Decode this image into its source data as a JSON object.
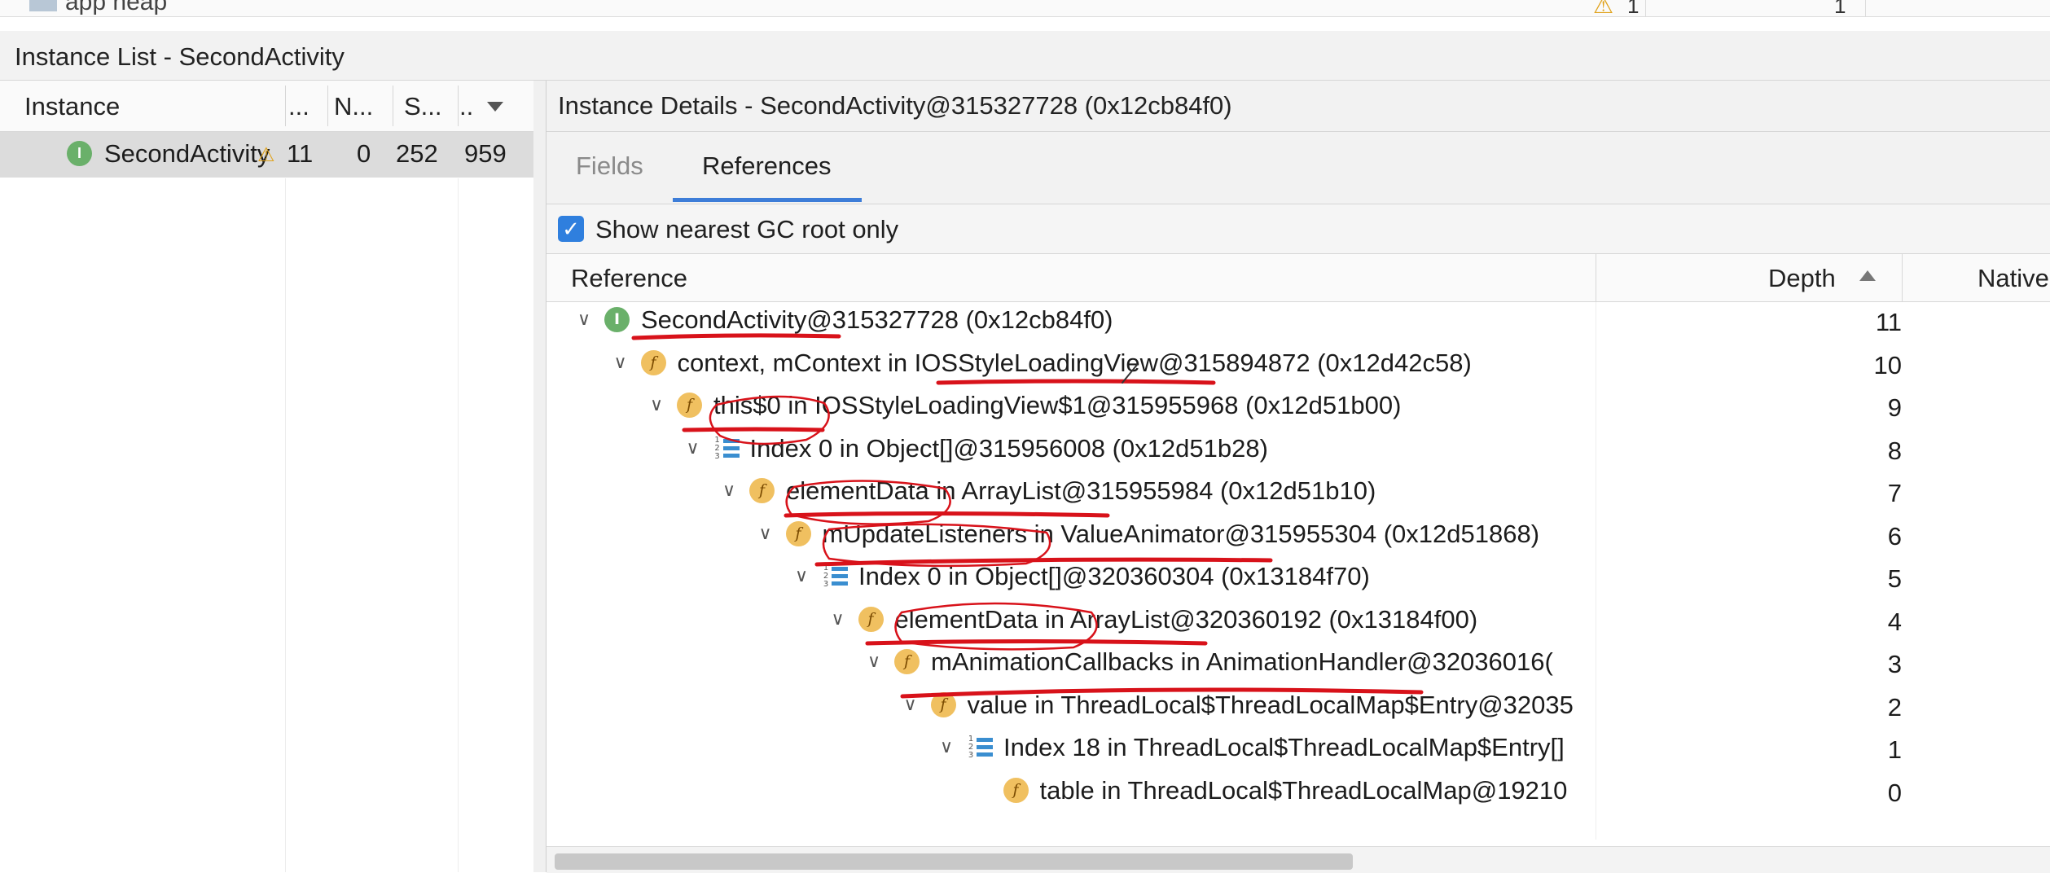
{
  "top_strip": {
    "title": "app heap",
    "warning_count": "1",
    "count": "1"
  },
  "instance_list": {
    "title": "Instance List - SecondActivity",
    "columns": [
      "Instance",
      "...",
      "N...",
      "S...",
      ".."
    ],
    "row": {
      "name": "SecondActivity",
      "depth": "11",
      "native": "0",
      "shallow": "252",
      "retained": "959"
    }
  },
  "details": {
    "title": "Instance Details - SecondActivity@315327728 (0x12cb84f0)",
    "tabs": {
      "fields": "Fields",
      "references": "References"
    },
    "gc_checkbox": {
      "label": "Show nearest GC root only",
      "checked": true
    },
    "columns": {
      "reference": "Reference",
      "depth": "Depth",
      "native": "Native"
    },
    "tree": [
      {
        "label": "SecondActivity@315327728 (0x12cb84f0)",
        "depth": "11",
        "icon": "instance-icon",
        "level": 0
      },
      {
        "label": "context, mContext in IOSStyleLoadingView@315894872 (0x12d42c58)",
        "depth": "10",
        "icon": "field-icon",
        "level": 1
      },
      {
        "label": "this$0 in IOSStyleLoadingView$1@315955968 (0x12d51b00)",
        "depth": "9",
        "icon": "field-icon",
        "level": 2
      },
      {
        "label": "Index 0 in Object[]@315956008 (0x12d51b28)",
        "depth": "8",
        "icon": "array-icon",
        "level": 3
      },
      {
        "label": "elementData in ArrayList@315955984 (0x12d51b10)",
        "depth": "7",
        "icon": "field-icon",
        "level": 4
      },
      {
        "label": "mUpdateListeners in ValueAnimator@315955304 (0x12d51868)",
        "depth": "6",
        "icon": "field-icon",
        "level": 5
      },
      {
        "label": "Index 0 in Object[]@320360304 (0x13184f70)",
        "depth": "5",
        "icon": "array-icon",
        "level": 6
      },
      {
        "label": "elementData in ArrayList@320360192 (0x13184f00)",
        "depth": "4",
        "icon": "field-icon",
        "level": 7
      },
      {
        "label": "mAnimationCallbacks in AnimationHandler@32036016(",
        "depth": "3",
        "icon": "field-icon",
        "level": 8
      },
      {
        "label": "value in ThreadLocal$ThreadLocalMap$Entry@32035",
        "depth": "2",
        "icon": "field-icon",
        "level": 9
      },
      {
        "label": "Index 18 in ThreadLocal$ThreadLocalMap$Entry[]",
        "depth": "1",
        "icon": "array-icon",
        "level": 10
      },
      {
        "label": "table in ThreadLocal$ThreadLocalMap@19210",
        "depth": "0",
        "icon": "field-icon",
        "level": 11
      }
    ]
  },
  "colors": {
    "accent": "#3d7dd8",
    "annotation": "#d8121a",
    "selected_row": "#dcdcdc"
  }
}
